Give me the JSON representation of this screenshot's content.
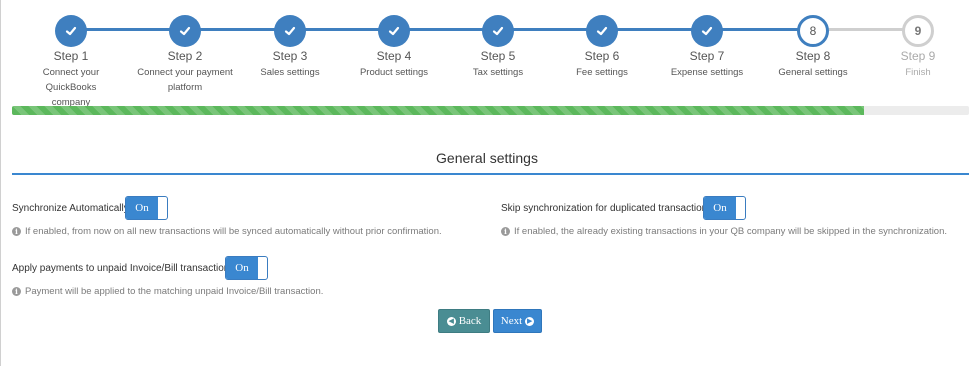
{
  "wizard": {
    "steps": [
      {
        "title": "Step 1",
        "subtitle_line1": "Connect your QuickBooks",
        "subtitle_line2": "company",
        "state": "done",
        "icon": "check-icon"
      },
      {
        "title": "Step 2",
        "subtitle_line1": "Connect your payment",
        "subtitle_line2": "platform",
        "state": "done",
        "icon": "check-icon"
      },
      {
        "title": "Step 3",
        "subtitle_line1": "Sales settings",
        "subtitle_line2": "",
        "state": "done",
        "icon": "check-icon"
      },
      {
        "title": "Step 4",
        "subtitle_line1": "Product settings",
        "subtitle_line2": "",
        "state": "done",
        "icon": "check-icon"
      },
      {
        "title": "Step 5",
        "subtitle_line1": "Tax settings",
        "subtitle_line2": "",
        "state": "done",
        "icon": "check-icon"
      },
      {
        "title": "Step 6",
        "subtitle_line1": "Fee settings",
        "subtitle_line2": "",
        "state": "done",
        "icon": "check-icon"
      },
      {
        "title": "Step 7",
        "subtitle_line1": "Expense settings",
        "subtitle_line2": "",
        "state": "done",
        "icon": "check-icon"
      },
      {
        "title": "Step 8",
        "subtitle_line1": "General settings",
        "subtitle_line2": "",
        "state": "current",
        "number": "8"
      },
      {
        "title": "Step 9",
        "subtitle_line1": "Finish",
        "subtitle_line2": "",
        "state": "pending",
        "number": "9"
      }
    ],
    "progress_fraction": 0.89,
    "colors": {
      "done": "#3f7fbf",
      "pending": "#cfcfcf",
      "progress": "#5cb85c"
    }
  },
  "section": {
    "title": "General settings"
  },
  "settings": {
    "sync_auto": {
      "label": "Synchronize Automatically",
      "toggle": "On",
      "hint": "If enabled, from now on all new transactions will be synced automatically without prior confirmation."
    },
    "skip_duplicates": {
      "label": "Skip synchronization for duplicated transactions",
      "toggle": "On",
      "hint": "If enabled, the already existing transactions in your QB company will be skipped in the synchronization."
    },
    "apply_payments": {
      "label": "Apply payments to unpaid Invoice/Bill transactions",
      "toggle": "On",
      "hint": "Payment will be applied to the matching unpaid Invoice/Bill transaction."
    }
  },
  "buttons": {
    "back": "Back",
    "next": "Next"
  },
  "icons": {
    "info": "info-icon",
    "back": "arrow-circle-left-icon",
    "next": "arrow-circle-right-icon"
  }
}
